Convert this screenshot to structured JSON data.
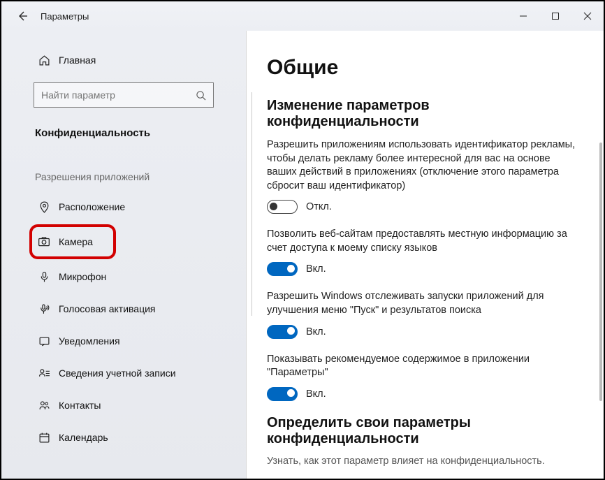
{
  "titlebar": {
    "title": "Параметры"
  },
  "sidebar": {
    "home": "Главная",
    "search_placeholder": "Найти параметр",
    "category": "Конфиденциальность",
    "section": "Разрешения приложений",
    "items": [
      {
        "label": "Расположение"
      },
      {
        "label": "Камера"
      },
      {
        "label": "Микрофон"
      },
      {
        "label": "Голосовая активация"
      },
      {
        "label": "Уведомления"
      },
      {
        "label": "Сведения учетной записи"
      },
      {
        "label": "Контакты"
      },
      {
        "label": "Календарь"
      }
    ]
  },
  "content": {
    "heading": "Общие",
    "subheading1": "Изменение параметров конфиденциальности",
    "settings": [
      {
        "desc": "Разрешить приложениям использовать идентификатор рекламы, чтобы делать рекламу более интересной для вас на основе ваших действий в приложениях (отключение этого параметра сбросит ваш идентификатор)",
        "state": "off",
        "state_label": "Откл."
      },
      {
        "desc": "Позволить веб-сайтам предоставлять местную информацию за счет доступа к моему списку языков",
        "state": "on",
        "state_label": "Вкл."
      },
      {
        "desc": "Разрешить Windows отслеживать запуски приложений для улучшения меню \"Пуск\" и результатов поиска",
        "state": "on",
        "state_label": "Вкл."
      },
      {
        "desc": "Показывать рекомендуемое содержимое в приложении \"Параметры\"",
        "state": "on",
        "state_label": "Вкл."
      }
    ],
    "subheading2": "Определить свои параметры конфиденциальности",
    "bottom_text": "Узнать, как этот параметр влияет на конфиденциальность."
  }
}
